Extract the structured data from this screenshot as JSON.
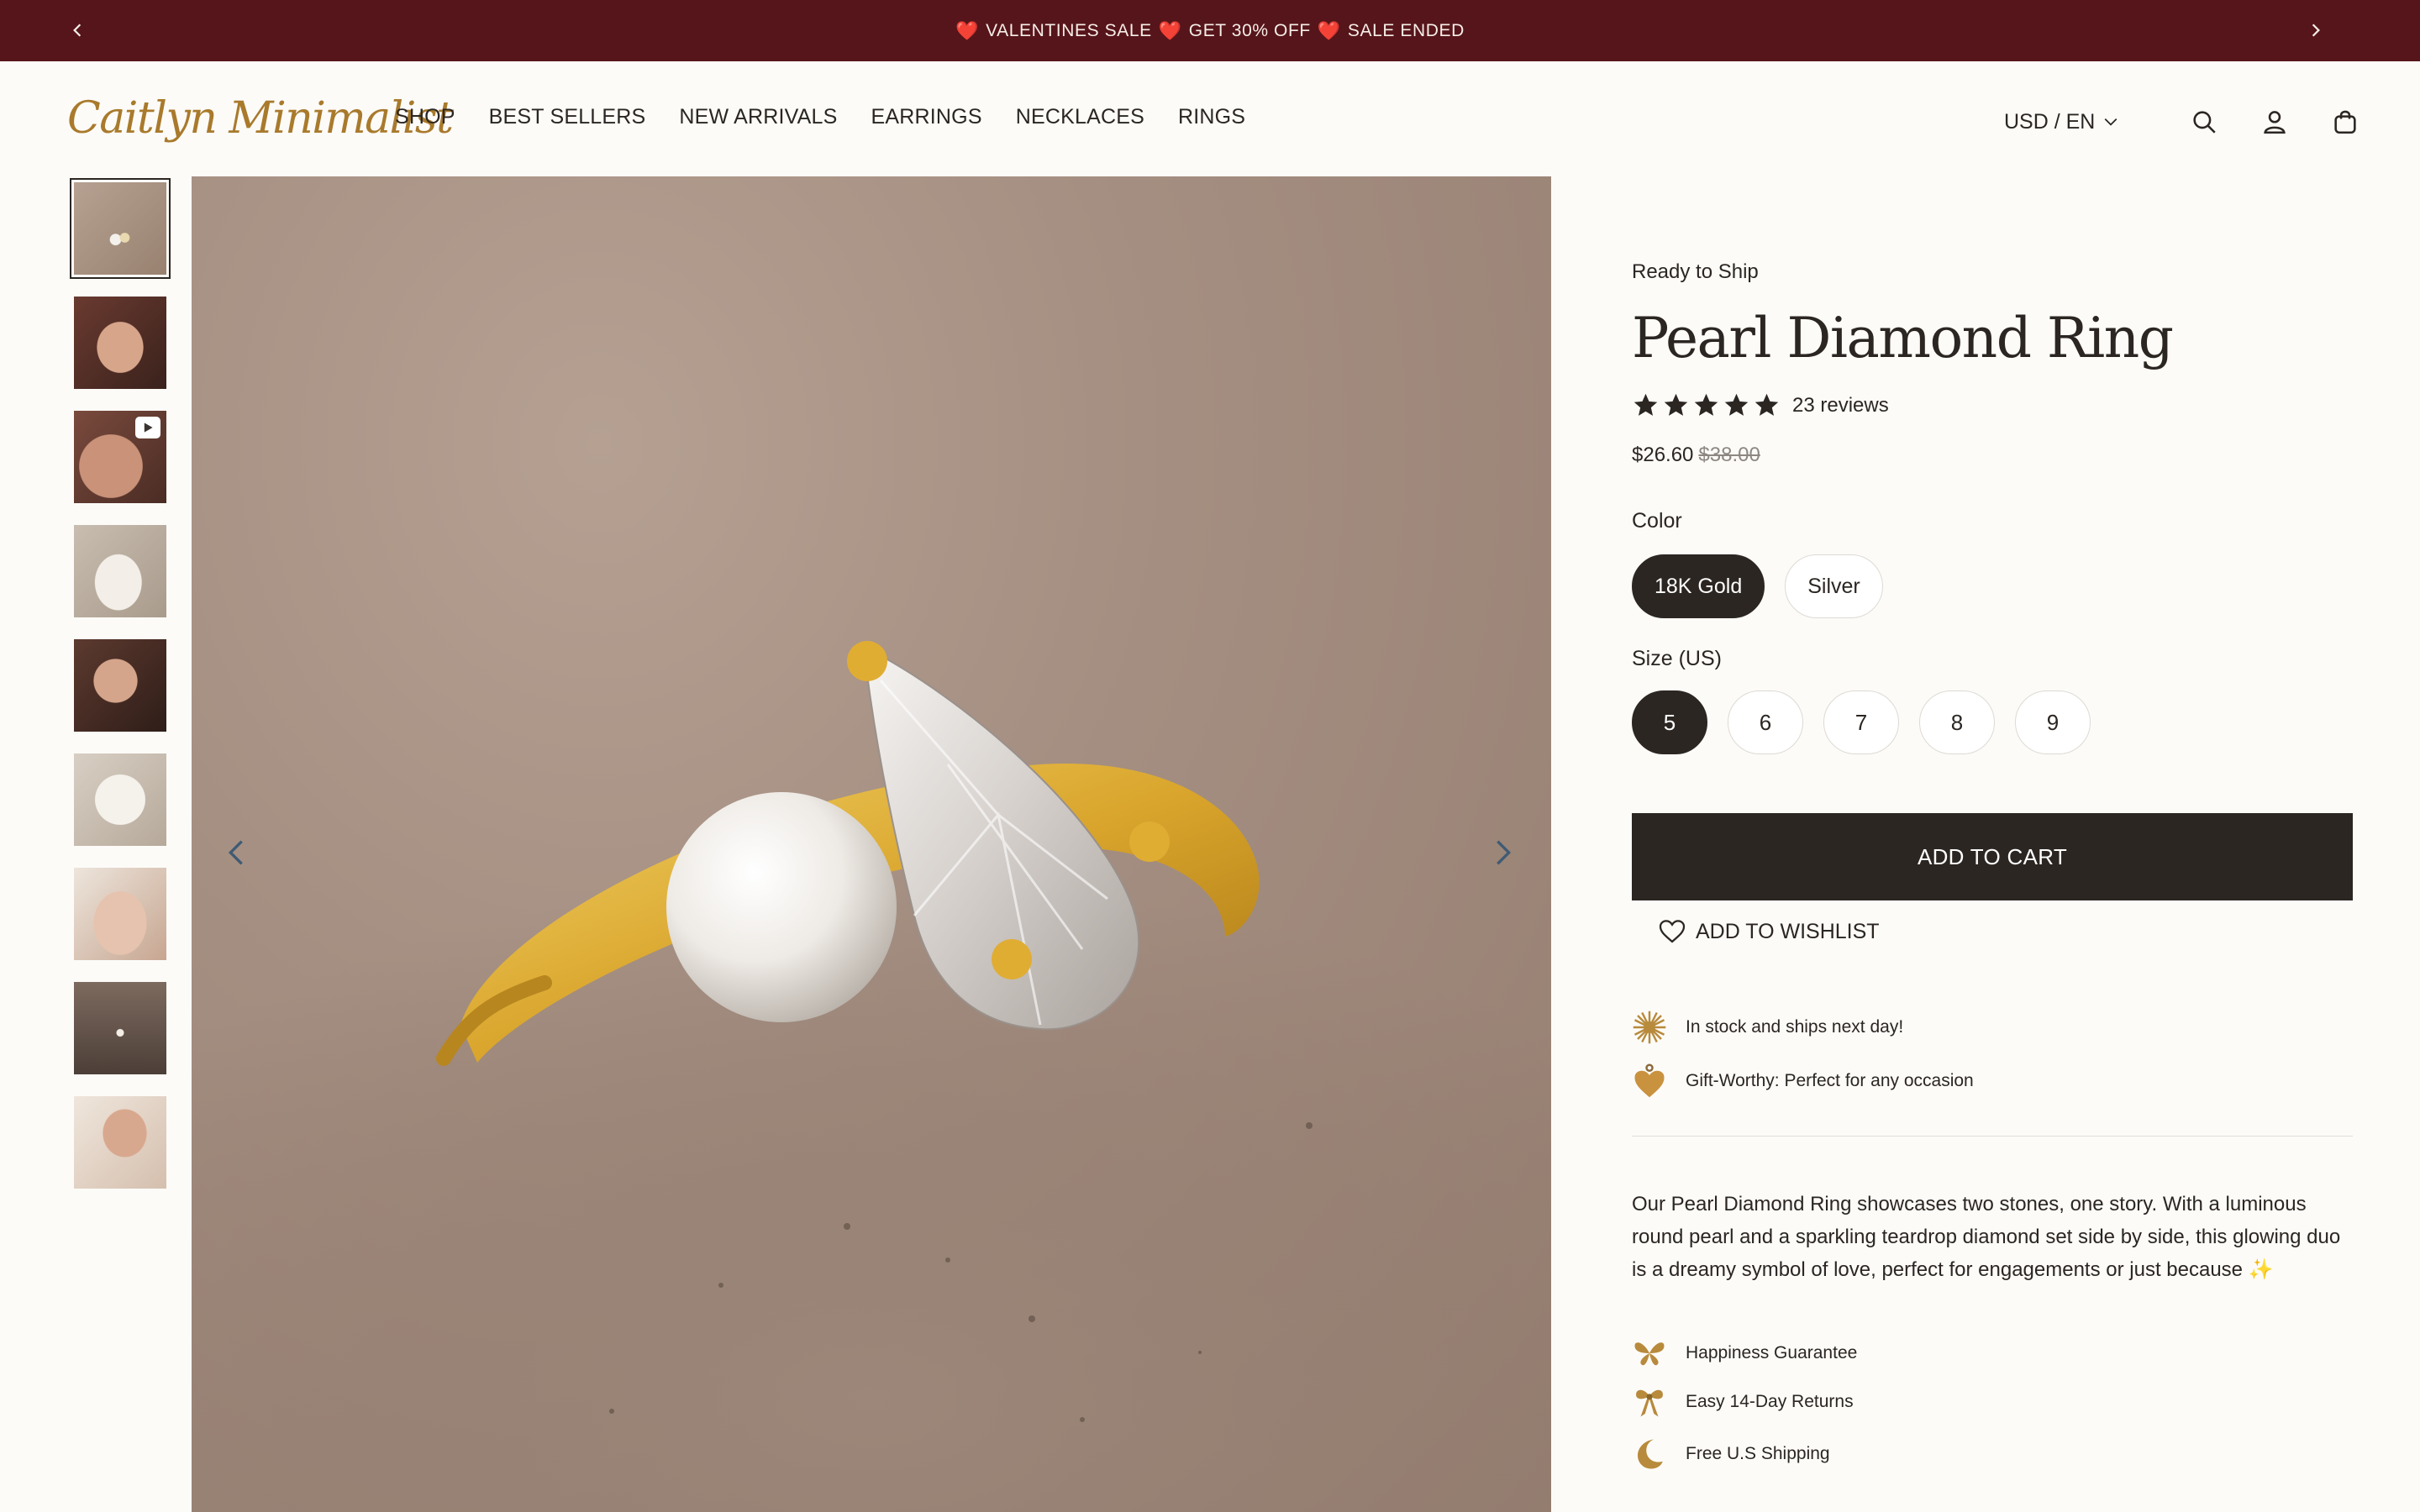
{
  "announcement": {
    "text_1": "VALENTINES SALE",
    "text_2": "GET 30% OFF",
    "text_3": "SALE ENDED",
    "heart_glyph": "❤️",
    "prev_icon": "chevron-left-icon",
    "next_icon": "chevron-right-icon",
    "background_color": "#56151a"
  },
  "header": {
    "logo": "Caitlyn Minimalist",
    "nav": [
      "SHOP",
      "BEST SELLERS",
      "NEW ARRIVALS",
      "EARRINGS",
      "NECKLACES",
      "RINGS"
    ],
    "currency": "USD / EN",
    "icons": [
      "search-icon",
      "user-icon",
      "bag-icon"
    ]
  },
  "gallery": {
    "thumbnail_count": 9,
    "active_index": 0,
    "video_thumbnail_index": 2
  },
  "product": {
    "availability": "Ready to Ship",
    "title": "Pearl Diamond Ring",
    "rating": 5,
    "reviews": "23 reviews",
    "price": "$26.60",
    "original_price": "$38.00",
    "color_label": "Color",
    "colors": [
      "18K Gold",
      "Silver"
    ],
    "selected_color": "18K Gold",
    "size_label": "Size (US)",
    "sizes": [
      "5",
      "6",
      "7",
      "8",
      "9"
    ],
    "selected_size": "5",
    "add_to_cart": "ADD TO CART",
    "wishlist": "ADD TO WISHLIST",
    "perks": [
      "In stock and ships next day!",
      "Gift-Worthy: Perfect for any occasion"
    ],
    "description": "Our Pearl Diamond Ring showcases two stones, one story. With a luminous round pearl and a sparkling teardrop diamond set side by side, this glowing duo is a dreamy symbol of love, perfect for engagements or just because",
    "description_emoji": "✨",
    "guarantees": [
      "Happiness Guarantee",
      "Easy 14-Day Returns",
      "Free U.S Shipping"
    ]
  },
  "colors": {
    "brand_dark": "#2b2622",
    "logo_gold": "#a97a2c",
    "perk_gold": "#b88a3c"
  }
}
